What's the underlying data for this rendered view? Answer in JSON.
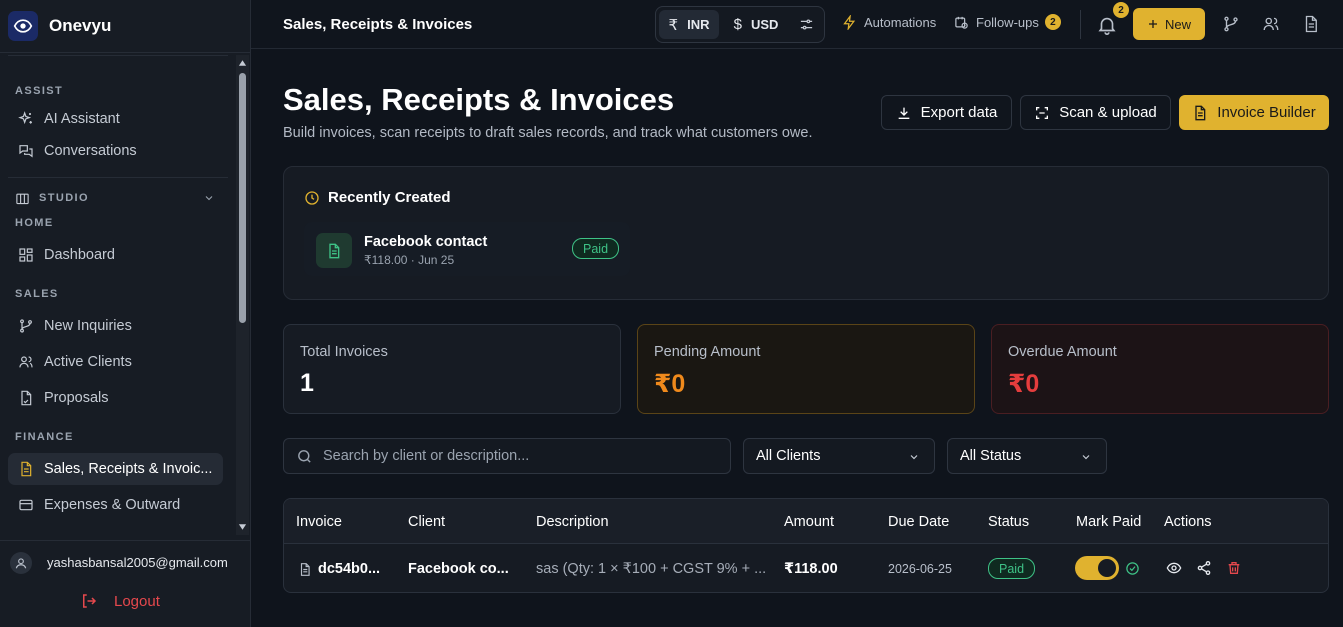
{
  "brand": {
    "name": "Onevyu"
  },
  "sidebar": {
    "assist_label": "ASSIST",
    "ai_assistant": "AI Assistant",
    "conversations": "Conversations",
    "studio_label": "STUDIO",
    "home_label": "HOME",
    "dashboard": "Dashboard",
    "sales_label": "SALES",
    "new_inquiries": "New Inquiries",
    "active_clients": "Active Clients",
    "proposals": "Proposals",
    "finance_label": "FINANCE",
    "sales_receipts": "Sales, Receipts & Invoic...",
    "expenses": "Expenses & Outward"
  },
  "user": {
    "email": "yashasbansal2005@gmail.com",
    "logout": "Logout"
  },
  "topbar": {
    "title": "Sales, Receipts & Invoices",
    "currency_inr_symbol": "₹",
    "currency_inr": "INR",
    "currency_usd_symbol": "$",
    "currency_usd": "USD",
    "automations": "Automations",
    "followups": "Follow-ups",
    "followups_count": "2",
    "notif_count": "2",
    "new_label": "New"
  },
  "page": {
    "title": "Sales, Receipts & Invoices",
    "subtitle": "Build invoices, scan receipts to draft sales records, and track what customers owe.",
    "export": "Export data",
    "scan": "Scan & upload",
    "builder": "Invoice Builder"
  },
  "recent": {
    "title": "Recently Created",
    "item_name": "Facebook contact",
    "item_meta": "₹118.00 · Jun 25",
    "item_status": "Paid"
  },
  "stats": {
    "total_label": "Total Invoices",
    "total_value": "1",
    "pending_label": "Pending Amount",
    "pending_value": "₹0",
    "overdue_label": "Overdue Amount",
    "overdue_value": "₹0"
  },
  "filters": {
    "search_placeholder": "Search by client or description...",
    "clients": "All Clients",
    "status": "All Status"
  },
  "table": {
    "headers": [
      "Invoice",
      "Client",
      "Description",
      "Amount",
      "Due Date",
      "Status",
      "Mark Paid",
      "Actions"
    ],
    "rows": [
      {
        "invoice": "dc54b0...",
        "client": "Facebook co...",
        "description": "sas (Qty: 1 × ₹100 + CGST 9% + ...",
        "amount": "₹118.00",
        "due": "2026-06-25",
        "status": "Paid",
        "mark_paid": true
      }
    ]
  },
  "colors": {
    "accent": "#e0b22f",
    "success": "#3ec286",
    "warning": "#f08a1c",
    "danger": "#e43d3d"
  }
}
